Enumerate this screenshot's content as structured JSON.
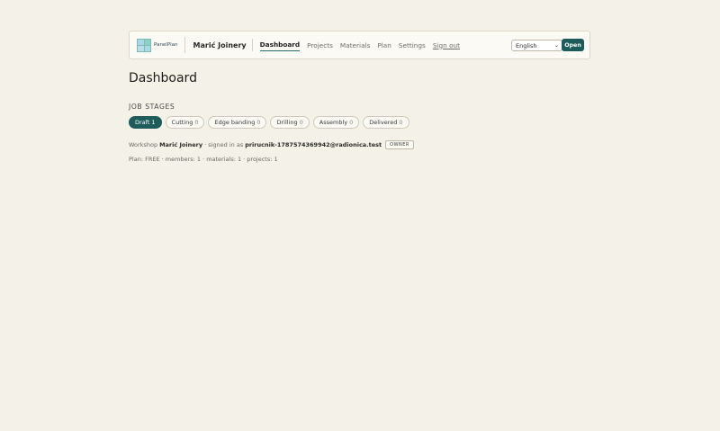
{
  "header": {
    "brand_name": "PanelPlan",
    "workshop_name": "Marić Joinery",
    "nav": [
      {
        "label": "Dashboard",
        "active": true
      },
      {
        "label": "Projects"
      },
      {
        "label": "Materials"
      },
      {
        "label": "Plan"
      },
      {
        "label": "Settings"
      }
    ],
    "sign_out_label": "Sign out",
    "language_value": "English",
    "open_button_label": "Open"
  },
  "page": {
    "title": "Dashboard",
    "section_label": "JOB STAGES"
  },
  "stages": [
    {
      "label": "Draft",
      "count": "1",
      "active": true
    },
    {
      "label": "Cutting",
      "count": "0"
    },
    {
      "label": "Edge banding",
      "count": "0"
    },
    {
      "label": "Drilling",
      "count": "0"
    },
    {
      "label": "Assembly",
      "count": "0"
    },
    {
      "label": "Delivered",
      "count": "0"
    }
  ],
  "info": {
    "workshop_prefix": "Workshop",
    "workshop_name": "Marić Joinery",
    "signed_in_text": "· signed in as",
    "email": "prirucnik-1787574369942@radionica.test",
    "role_badge": "OWNER",
    "plan_line": "Plan: FREE · members: 1 · materials: 1 · projects: 1"
  },
  "colors": {
    "accent": "#1e5c5c",
    "background": "#f4f1e8"
  }
}
